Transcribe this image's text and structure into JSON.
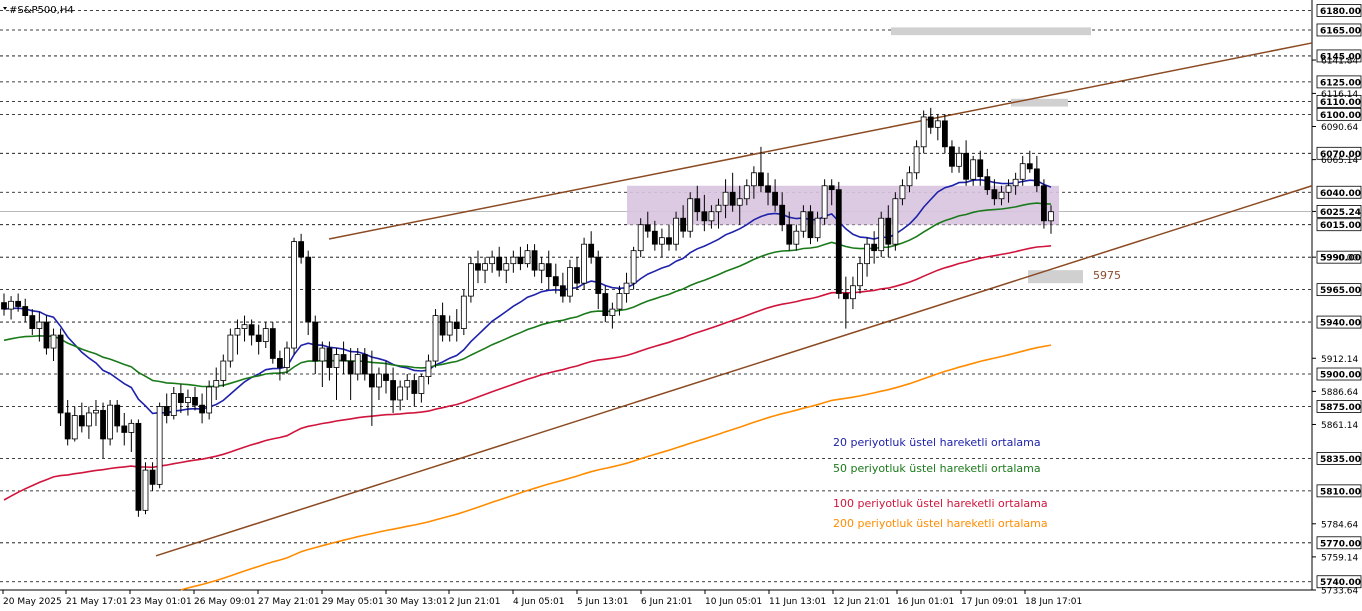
{
  "chart_data": {
    "type": "candlestick",
    "title": "#S&P500,H4",
    "ylim": [
      5733.64,
      6185.0
    ],
    "price_ticks": [
      6141.84,
      6116.14,
      6090.64,
      6065.14,
      6025.24,
      5990.0,
      5912.14,
      5886.64,
      5861.14,
      5784.64,
      5759.14,
      5733.64
    ],
    "level_lines": [
      6180.0,
      6165.0,
      6145.0,
      6125.0,
      6110.0,
      6100.0,
      6070.0,
      6040.0,
      6015.0,
      5990.0,
      5965.0,
      5940.0,
      5900.0,
      5875.0,
      5835.0,
      5810.0,
      5770.0,
      5740.0
    ],
    "current_price": 6025.24,
    "x_labels": [
      "20 May 2025",
      "21 May 17:01",
      "23 May 01:01",
      "26 May 09:01",
      "27 May 21:01",
      "29 May 05:01",
      "30 May 13:01",
      "2 Jun 21:01",
      "4 Jun 05:01",
      "5 Jun 13:01",
      "6 Jun 21:01",
      "10 Jun 05:01",
      "11 Jun 13:01",
      "12 Jun 21:01",
      "16 Jun 01:01",
      "17 Jun 09:01",
      "18 Jun 17:01"
    ],
    "annotation": "5975",
    "legend": [
      {
        "name": "20 periyotluk üstel hareketli ortalama",
        "color": "#1e22aa"
      },
      {
        "name": "50 periyotluk üstel hareketli ortalama",
        "color": "#1a7a1a"
      },
      {
        "name": "100 periyotluk üstel hareketli ortalama",
        "color": "#d0143c"
      },
      {
        "name": "200 periyotluk üstel hareketli ortalama",
        "color": "#ff8c00"
      }
    ],
    "candles": [
      [
        5955,
        5962,
        5945,
        5950
      ],
      [
        5950,
        5960,
        5942,
        5956
      ],
      [
        5956,
        5962,
        5948,
        5952
      ],
      [
        5952,
        5958,
        5940,
        5945
      ],
      [
        5945,
        5950,
        5930,
        5935
      ],
      [
        5935,
        5948,
        5925,
        5940
      ],
      [
        5940,
        5945,
        5915,
        5920
      ],
      [
        5920,
        5935,
        5910,
        5930
      ],
      [
        5930,
        5935,
        5860,
        5870
      ],
      [
        5870,
        5880,
        5845,
        5850
      ],
      [
        5850,
        5875,
        5848,
        5868
      ],
      [
        5868,
        5878,
        5855,
        5860
      ],
      [
        5860,
        5875,
        5850,
        5870
      ],
      [
        5870,
        5880,
        5860,
        5872
      ],
      [
        5872,
        5878,
        5835,
        5850
      ],
      [
        5850,
        5880,
        5845,
        5876
      ],
      [
        5876,
        5880,
        5855,
        5860
      ],
      [
        5860,
        5870,
        5845,
        5855
      ],
      [
        5855,
        5865,
        5840,
        5862
      ],
      [
        5862,
        5865,
        5790,
        5795
      ],
      [
        5795,
        5832,
        5792,
        5826
      ],
      [
        5826,
        5832,
        5810,
        5815
      ],
      [
        5815,
        5878,
        5812,
        5875
      ],
      [
        5875,
        5885,
        5862,
        5868
      ],
      [
        5868,
        5890,
        5865,
        5885
      ],
      [
        5885,
        5892,
        5870,
        5878
      ],
      [
        5878,
        5888,
        5868,
        5882
      ],
      [
        5882,
        5890,
        5872,
        5876
      ],
      [
        5876,
        5885,
        5862,
        5870
      ],
      [
        5870,
        5895,
        5865,
        5890
      ],
      [
        5890,
        5905,
        5880,
        5895
      ],
      [
        5895,
        5915,
        5890,
        5910
      ],
      [
        5910,
        5935,
        5905,
        5930
      ],
      [
        5930,
        5942,
        5915,
        5935
      ],
      [
        5935,
        5945,
        5925,
        5938
      ],
      [
        5938,
        5942,
        5922,
        5930
      ],
      [
        5930,
        5938,
        5915,
        5925
      ],
      [
        5925,
        5940,
        5920,
        5935
      ],
      [
        5935,
        5940,
        5908,
        5912
      ],
      [
        5912,
        5918,
        5895,
        5905
      ],
      [
        5905,
        5925,
        5900,
        5920
      ],
      [
        5920,
        6005,
        5915,
        6002
      ],
      [
        6002,
        6008,
        5985,
        5990
      ],
      [
        5990,
        5995,
        5930,
        5940
      ],
      [
        5940,
        5945,
        5900,
        5910
      ],
      [
        5910,
        5925,
        5890,
        5920
      ],
      [
        5920,
        5925,
        5895,
        5905
      ],
      [
        5905,
        5920,
        5880,
        5915
      ],
      [
        5915,
        5925,
        5900,
        5910
      ],
      [
        5910,
        5920,
        5880,
        5900
      ],
      [
        5900,
        5920,
        5895,
        5915
      ],
      [
        5915,
        5920,
        5895,
        5900
      ],
      [
        5900,
        5918,
        5860,
        5890
      ],
      [
        5890,
        5905,
        5880,
        5900
      ],
      [
        5900,
        5910,
        5885,
        5895
      ],
      [
        5895,
        5905,
        5870,
        5880
      ],
      [
        5880,
        5895,
        5872,
        5890
      ],
      [
        5890,
        5900,
        5880,
        5895
      ],
      [
        5895,
        5900,
        5875,
        5885
      ],
      [
        5885,
        5900,
        5878,
        5898
      ],
      [
        5898,
        5915,
        5892,
        5910
      ],
      [
        5910,
        5950,
        5905,
        5945
      ],
      [
        5945,
        5955,
        5925,
        5930
      ],
      [
        5930,
        5945,
        5925,
        5940
      ],
      [
        5940,
        5950,
        5925,
        5935
      ],
      [
        5935,
        5965,
        5930,
        5960
      ],
      [
        5960,
        5990,
        5955,
        5985
      ],
      [
        5985,
        5995,
        5970,
        5980
      ],
      [
        5980,
        5990,
        5970,
        5985
      ],
      [
        5985,
        5995,
        5978,
        5990
      ],
      [
        5990,
        5998,
        5975,
        5980
      ],
      [
        5980,
        5990,
        5970,
        5985
      ],
      [
        5985,
        5995,
        5978,
        5990
      ],
      [
        5990,
        5998,
        5980,
        5985
      ],
      [
        5985,
        6000,
        5982,
        5995
      ],
      [
        5995,
        6000,
        5975,
        5980
      ],
      [
        5980,
        5990,
        5970,
        5985
      ],
      [
        5985,
        5995,
        5965,
        5975
      ],
      [
        5975,
        5985,
        5962,
        5968
      ],
      [
        5968,
        5978,
        5955,
        5960
      ],
      [
        5960,
        5988,
        5955,
        5982
      ],
      [
        5982,
        5990,
        5965,
        5970
      ],
      [
        5970,
        6005,
        5965,
        6000
      ],
      [
        6000,
        6010,
        5985,
        5990
      ],
      [
        5990,
        5995,
        5950,
        5962
      ],
      [
        5962,
        5968,
        5940,
        5945
      ],
      [
        5945,
        5955,
        5935,
        5950
      ],
      [
        5950,
        5968,
        5945,
        5962
      ],
      [
        5962,
        5978,
        5955,
        5970
      ],
      [
        5970,
        5998,
        5965,
        5995
      ],
      [
        5995,
        6020,
        5990,
        6015
      ],
      [
        6015,
        6025,
        6005,
        6010
      ],
      [
        6010,
        6018,
        5995,
        6000
      ],
      [
        6000,
        6012,
        5990,
        6005
      ],
      [
        6005,
        6015,
        5995,
        6000
      ],
      [
        6000,
        6025,
        5995,
        6020
      ],
      [
        6020,
        6030,
        6005,
        6010
      ],
      [
        6010,
        6040,
        6005,
        6035
      ],
      [
        6035,
        6045,
        6018,
        6025
      ],
      [
        6025,
        6038,
        6010,
        6018
      ],
      [
        6018,
        6030,
        6012,
        6025
      ],
      [
        6025,
        6035,
        6012,
        6030
      ],
      [
        6030,
        6050,
        6020,
        6040
      ],
      [
        6040,
        6055,
        6025,
        6030
      ],
      [
        6030,
        6045,
        6015,
        6035
      ],
      [
        6035,
        6050,
        6030,
        6045
      ],
      [
        6045,
        6060,
        6035,
        6055
      ],
      [
        6055,
        6075,
        6040,
        6045
      ],
      [
        6045,
        6055,
        6030,
        6040
      ],
      [
        6040,
        6050,
        6025,
        6030
      ],
      [
        6030,
        6040,
        6010,
        6015
      ],
      [
        6015,
        6025,
        5995,
        6000
      ],
      [
        6000,
        6015,
        5995,
        6010
      ],
      [
        6010,
        6030,
        6005,
        6025
      ],
      [
        6025,
        6030,
        6000,
        6005
      ],
      [
        6005,
        6025,
        6002,
        6020
      ],
      [
        6020,
        6050,
        6015,
        6045
      ],
      [
        6045,
        6050,
        6030,
        6042
      ],
      [
        6042,
        6048,
        5958,
        5962
      ],
      [
        5962,
        5975,
        5935,
        5958
      ],
      [
        5958,
        5975,
        5950,
        5968
      ],
      [
        5968,
        5990,
        5962,
        5985
      ],
      [
        5985,
        6005,
        5975,
        6000
      ],
      [
        6000,
        6010,
        5985,
        5995
      ],
      [
        5995,
        6025,
        5990,
        6020
      ],
      [
        6020,
        6030,
        5990,
        6000
      ],
      [
        6000,
        6040,
        5995,
        6035
      ],
      [
        6035,
        6050,
        6030,
        6045
      ],
      [
        6045,
        6060,
        6040,
        6055
      ],
      [
        6055,
        6080,
        6050,
        6075
      ],
      [
        6075,
        6103,
        6070,
        6098
      ],
      [
        6098,
        6105,
        6085,
        6090
      ],
      [
        6090,
        6100,
        6080,
        6095
      ],
      [
        6095,
        6100,
        6070,
        6075
      ],
      [
        6075,
        6080,
        6055,
        6060
      ],
      [
        6060,
        6075,
        6055,
        6070
      ],
      [
        6070,
        6080,
        6045,
        6050
      ],
      [
        6050,
        6068,
        6045,
        6065
      ],
      [
        6065,
        6072,
        6045,
        6052
      ],
      [
        6052,
        6058,
        6038,
        6042
      ],
      [
        6042,
        6050,
        6030,
        6035
      ],
      [
        6035,
        6045,
        6030,
        6040
      ],
      [
        6040,
        6050,
        6032,
        6045
      ],
      [
        6045,
        6055,
        6038,
        6050
      ],
      [
        6050,
        6068,
        6045,
        6062
      ],
      [
        6062,
        6072,
        6055,
        6058
      ],
      [
        6058,
        6068,
        6040,
        6045
      ],
      [
        6045,
        6050,
        6012,
        6018
      ],
      [
        6018,
        6030,
        6008,
        6025
      ]
    ]
  }
}
